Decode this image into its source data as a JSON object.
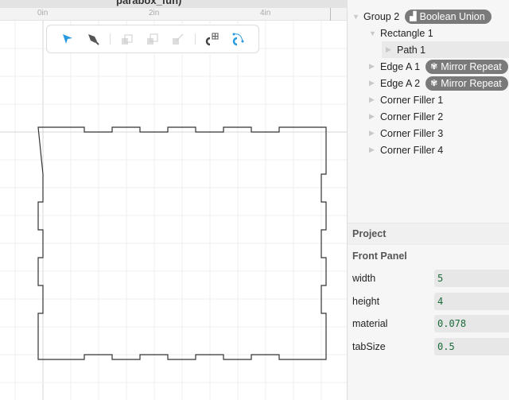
{
  "window": {
    "title": "parabox_fun)"
  },
  "ruler": {
    "labels": [
      {
        "text": "0in",
        "inch": 0
      },
      {
        "text": "2in",
        "inch": 2
      },
      {
        "text": "4in",
        "inch": 4
      }
    ]
  },
  "toolbar": {
    "tools": [
      "select-arrow-icon",
      "pen-icon",
      "boolean-front-icon",
      "boolean-back-icon",
      "transform-icon",
      "snap-grid-icon",
      "snap-points-icon"
    ]
  },
  "panel": {
    "width_in": 5,
    "height_in": 4,
    "tab_size_in": 0.5,
    "material_in": 0.078
  },
  "colors": {
    "accent": "#2a9ae0",
    "value_text": "#1b6b3a"
  },
  "layers": [
    {
      "label": "Group 2",
      "badge": "Boolean Union"
    },
    {
      "label": "Rectangle 1"
    },
    {
      "label": "Path 1"
    },
    {
      "label": "Edge A 1",
      "badge": "Mirror Repeat"
    },
    {
      "label": "Edge A 2",
      "badge": "Mirror Repeat"
    },
    {
      "label": "Corner Filler 1"
    },
    {
      "label": "Corner Filler 2"
    },
    {
      "label": "Corner Filler 3"
    },
    {
      "label": "Corner Filler 4"
    }
  ],
  "inspector": {
    "section": "Project",
    "group": "Front Panel",
    "params": [
      {
        "name": "width",
        "value": "5"
      },
      {
        "name": "height",
        "value": "4"
      },
      {
        "name": "material",
        "value": "0.078"
      },
      {
        "name": "tabSize",
        "value": "0.5"
      }
    ]
  }
}
